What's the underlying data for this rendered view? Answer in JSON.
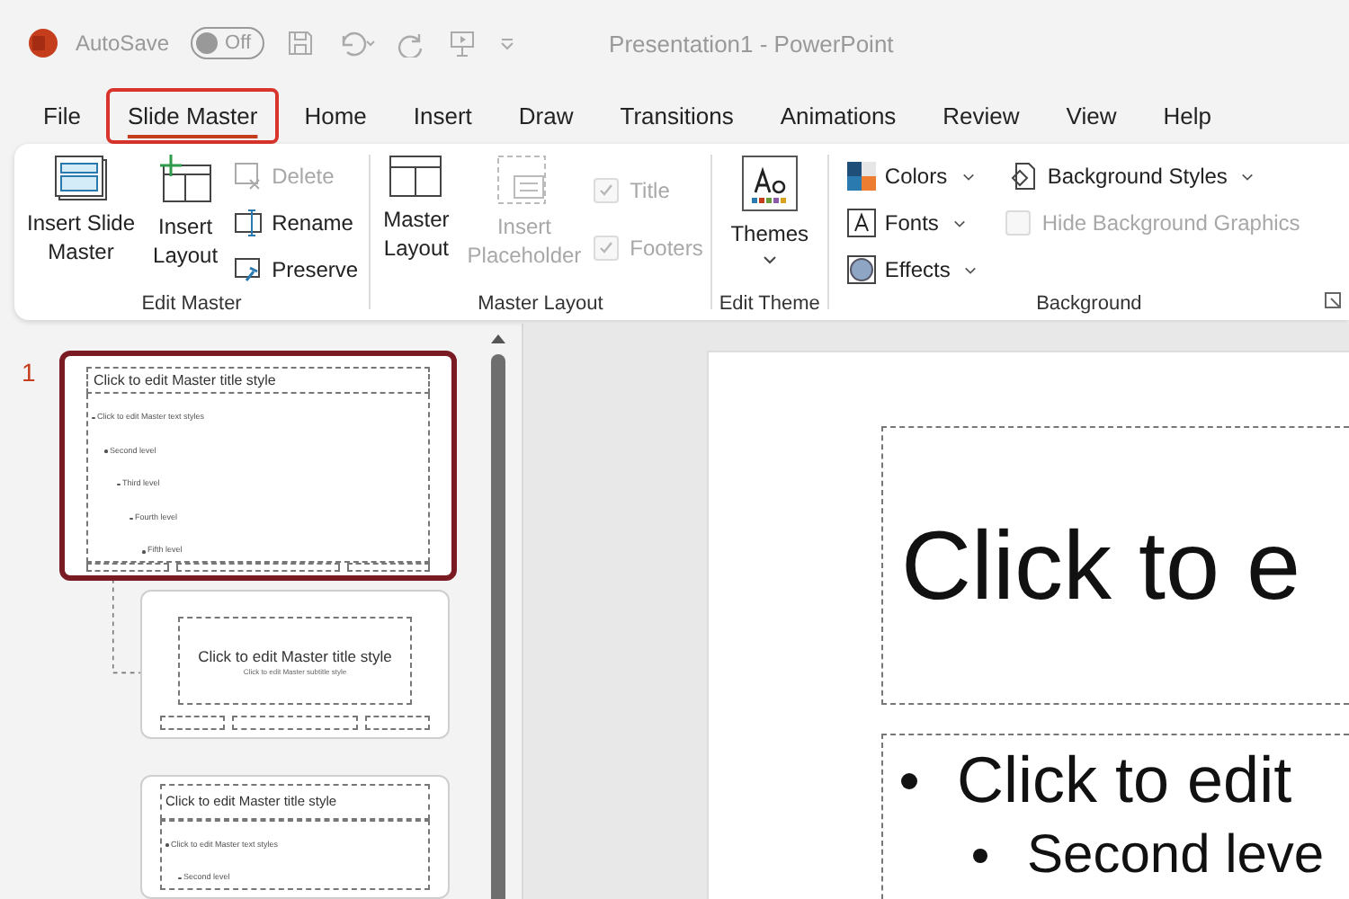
{
  "quick_access": {
    "autosave_label": "AutoSave",
    "autosave_toggle": {
      "label": "Off",
      "on": false
    }
  },
  "window": {
    "title": "Presentation1  -  PowerPoint"
  },
  "tabs": [
    {
      "label": "File",
      "selected": false
    },
    {
      "label": "Slide Master",
      "selected": true
    },
    {
      "label": "Home",
      "selected": false
    },
    {
      "label": "Insert",
      "selected": false
    },
    {
      "label": "Draw",
      "selected": false
    },
    {
      "label": "Transitions",
      "selected": false
    },
    {
      "label": "Animations",
      "selected": false
    },
    {
      "label": "Review",
      "selected": false
    },
    {
      "label": "View",
      "selected": false
    },
    {
      "label": "Help",
      "selected": false
    }
  ],
  "ribbon": {
    "edit_master": {
      "label": "Edit Master",
      "insert_slide_master": {
        "label": "Insert Slide\nMaster"
      },
      "insert_layout": {
        "label": "Insert\nLayout"
      },
      "delete": {
        "label": "Delete",
        "disabled": true
      },
      "rename": {
        "label": "Rename",
        "disabled": false
      },
      "preserve": {
        "label": "Preserve",
        "disabled": false
      }
    },
    "master_layout": {
      "label": "Master Layout",
      "master_layout": {
        "label": "Master\nLayout"
      },
      "insert_placeholder": {
        "label": "Insert\nPlaceholder",
        "disabled": true
      },
      "title": {
        "label": "Title",
        "checked": true,
        "disabled": true
      },
      "footers": {
        "label": "Footers",
        "checked": true,
        "disabled": true
      }
    },
    "edit_theme": {
      "label": "Edit Theme",
      "themes": {
        "label": "Themes"
      }
    },
    "background": {
      "label": "Background",
      "colors": {
        "label": "Colors"
      },
      "fonts": {
        "label": "Fonts"
      },
      "effects": {
        "label": "Effects"
      },
      "background_styles": {
        "label": "Background Styles"
      },
      "hide_background_graphics": {
        "label": "Hide Background Graphics",
        "checked": false,
        "disabled": true
      }
    }
  },
  "thumbnails": [
    {
      "number": "1",
      "selected": true,
      "title": "Click to edit Master title style",
      "body": [
        {
          "text": "Click to edit Master text styles",
          "children": [
            {
              "text": "Second level",
              "children": [
                {
                  "text": "Third level",
                  "children": [
                    {
                      "text": "Fourth level",
                      "children": [
                        {
                          "text": "Fifth level"
                        }
                      ]
                    }
                  ]
                }
              ]
            }
          ]
        }
      ],
      "children": [
        {
          "kind": "title",
          "selected": false,
          "title": "Click to edit Master title style",
          "subtitle": "Click to edit Master subtitle style"
        },
        {
          "kind": "content",
          "selected": false,
          "title": "Click to edit Master title style",
          "body": [
            {
              "text": "Click to edit Master text styles",
              "children": [
                {
                  "text": "Second level"
                }
              ]
            }
          ]
        }
      ]
    }
  ],
  "slide": {
    "title": "Click to e",
    "body": [
      {
        "text": "Click to edit",
        "children": [
          {
            "text": "Second leve"
          }
        ]
      }
    ]
  }
}
